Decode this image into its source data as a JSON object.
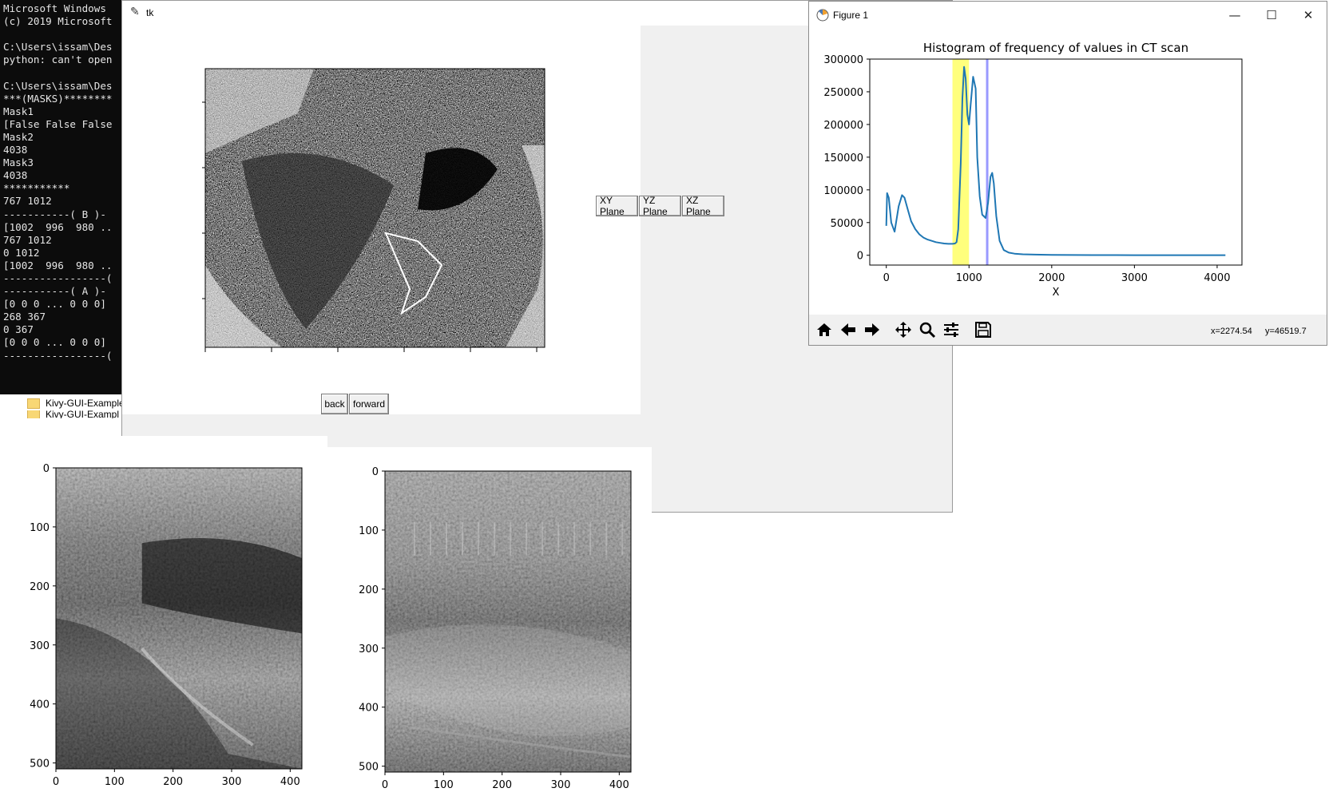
{
  "console": {
    "lines": [
      "Microsoft Windows",
      "(c) 2019 Microsoft",
      "",
      "C:\\Users\\issam\\Des",
      "python: can't open",
      "",
      "C:\\Users\\issam\\Des",
      "***(MASKS)********",
      "Mask1",
      "[False False False",
      "Mask2",
      "4038",
      "Mask3",
      "4038",
      "***********",
      "767 1012",
      "-----------( B )-",
      "[1002  996  980 ..",
      "767 1012",
      "0 1012",
      "[1002  996  980 ..",
      "-----------------(",
      "-----------( A )-",
      "[0 0 0 ... 0 0 0]",
      "268 367",
      "0 367",
      "[0 0 0 ... 0 0 0]",
      "-----------------("
    ]
  },
  "explorer": {
    "items": [
      "Kivy-GUI-Example",
      "Kivy-GUI-Exampl"
    ]
  },
  "tk_window": {
    "title": "tk",
    "buttons": {
      "xy": "XY Plane",
      "yz": "YZ Plane",
      "xz": "XZ Plane",
      "back": "back",
      "forward": "forward"
    }
  },
  "figure_window": {
    "title": "Figure 1",
    "minimize": "—",
    "maximize": "☐",
    "close": "✕",
    "coords_x": "x=2274.54",
    "coords_y": "y=46519.7",
    "toolbar_icons": [
      "home-icon",
      "back-arrow-icon",
      "forward-arrow-icon",
      "pan-icon",
      "zoom-icon",
      "configure-subplots-icon",
      "save-icon"
    ]
  },
  "chart_data": [
    {
      "type": "line",
      "title": "Histogram of frequency of values in CT scan",
      "xlabel": "X",
      "ylabel": "",
      "xlim": [
        -200,
        4300
      ],
      "ylim": [
        -15000,
        300000
      ],
      "xticks": [
        0,
        1000,
        2000,
        3000,
        4000
      ],
      "yticks": [
        0,
        50000,
        100000,
        150000,
        200000,
        250000,
        300000
      ],
      "highlight_span": {
        "x0": 800,
        "x1": 1000,
        "color": "#ffff66"
      },
      "vline": {
        "x": 1220,
        "color": "#9999ff"
      },
      "line_color": "#1f77b4",
      "series": [
        {
          "x": [
            0,
            10,
            30,
            60,
            100,
            150,
            190,
            220,
            260,
            300,
            350,
            400,
            450,
            500,
            550,
            600,
            650,
            700,
            750,
            800,
            830,
            850,
            870,
            900,
            920,
            940,
            960,
            980,
            1000,
            1020,
            1050,
            1080,
            1100,
            1130,
            1160,
            1200,
            1230,
            1260,
            1280,
            1300,
            1330,
            1370,
            1420,
            1480,
            1550,
            1650,
            1800,
            2000,
            2500,
            3000,
            3500,
            4100
          ],
          "y": [
            45000,
            95000,
            88000,
            50000,
            36000,
            75000,
            92000,
            88000,
            70000,
            52000,
            40000,
            32000,
            27000,
            24000,
            22000,
            20000,
            19000,
            18000,
            17500,
            17500,
            18000,
            20000,
            40000,
            140000,
            240000,
            288000,
            270000,
            215000,
            200000,
            230000,
            273000,
            255000,
            150000,
            90000,
            62000,
            57000,
            80000,
            120000,
            126000,
            110000,
            60000,
            22000,
            8000,
            4000,
            2500,
            1500,
            1000,
            500,
            300,
            200,
            100,
            100
          ]
        }
      ]
    },
    {
      "type": "heatmap",
      "title": "",
      "xlabel": "",
      "ylabel": "",
      "xticks": [
        0,
        100,
        200,
        300,
        400
      ],
      "yticks": [
        0,
        100,
        200,
        300,
        400,
        500
      ],
      "xlim": [
        0,
        420
      ],
      "ylim": [
        510,
        0
      ]
    },
    {
      "type": "heatmap",
      "title": "",
      "xlabel": "",
      "ylabel": "",
      "xticks": [
        0,
        100,
        200,
        300,
        400
      ],
      "yticks": [
        0,
        100,
        200,
        300,
        400,
        500
      ],
      "xlim": [
        0,
        420
      ],
      "ylim": [
        510,
        0
      ]
    }
  ]
}
